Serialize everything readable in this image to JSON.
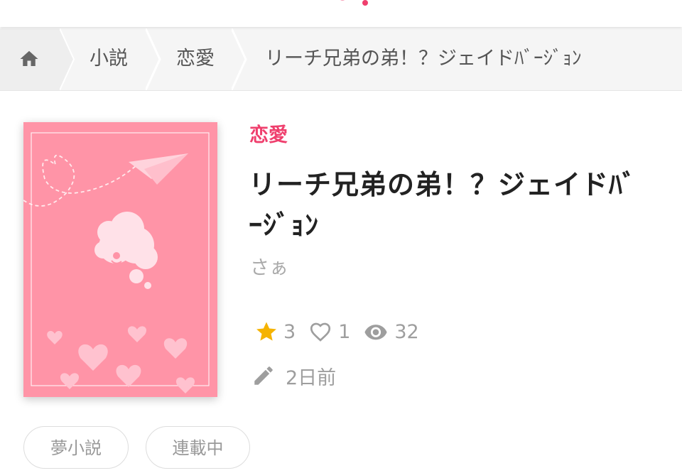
{
  "colors": {
    "accent": "#ef3f6d",
    "star": "#f5b301",
    "cover_bg": "#ff94a7",
    "muted": "#9e9e9e"
  },
  "breadcrumb": {
    "home_icon": "home-icon",
    "items": [
      {
        "label": "小説"
      },
      {
        "label": "恋愛"
      },
      {
        "label": "リーチ兄弟の弟！？ジェイドﾊﾞｰｼﾞｮﾝ"
      }
    ]
  },
  "book": {
    "genre": "恋愛",
    "title": "リーチ兄弟の弟！？ジェイドﾊﾞｰｼﾞｮﾝ",
    "author": "さぁ",
    "stats": {
      "stars": "3",
      "likes": "1",
      "views": "32"
    },
    "updated": "2日前"
  },
  "tags": [
    {
      "label": "夢小説"
    },
    {
      "label": "連載中"
    }
  ]
}
